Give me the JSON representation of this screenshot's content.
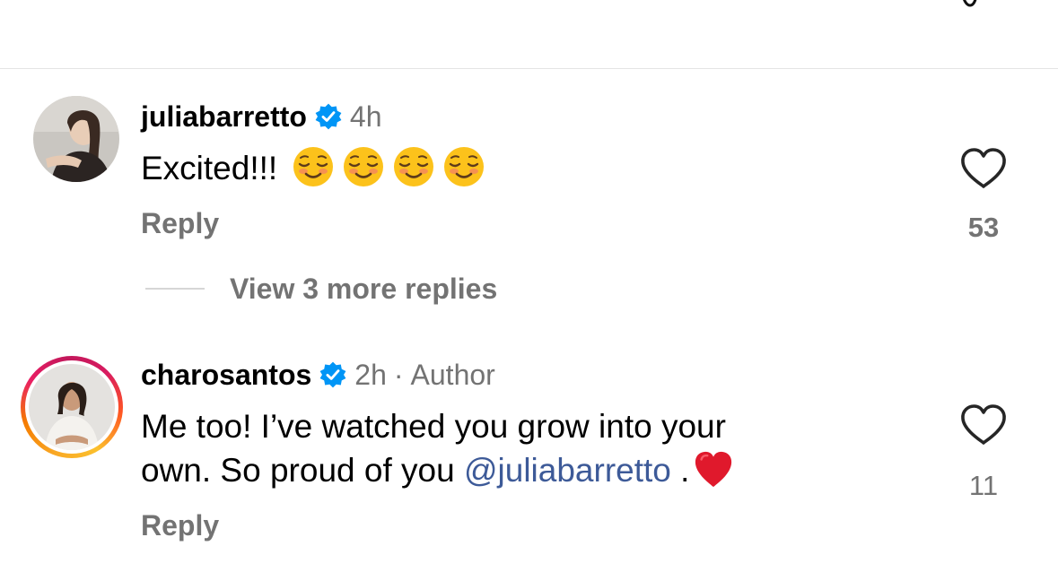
{
  "comments": [
    {
      "username": "juliabarretto",
      "time": "4h",
      "text": "Excited!!!",
      "emoji_count": 4,
      "reply_label": "Reply",
      "likes": "53"
    },
    {
      "username": "charosantos",
      "time": "2h",
      "separator": "·",
      "author_badge": "Author",
      "text_line1": "Me too! I’ve watched you grow into your",
      "text_line2_prefix": "own. So proud of you ",
      "mention": "@juliabarretto",
      "text_line2_suffix": " .",
      "reply_label": "Reply",
      "likes": "11"
    }
  ],
  "view_more_replies": "View 3 more replies",
  "icons": {
    "verified": "verified-badge-icon",
    "like": "heart-outline-icon",
    "emoji": "smiling-face-emoji",
    "heart_emoji": "red-heart-emoji"
  },
  "colors": {
    "verified_blue": "#0095f6",
    "secondary_text": "#737373",
    "mention": "#3d5a98",
    "red_heart": "#e0192c"
  }
}
